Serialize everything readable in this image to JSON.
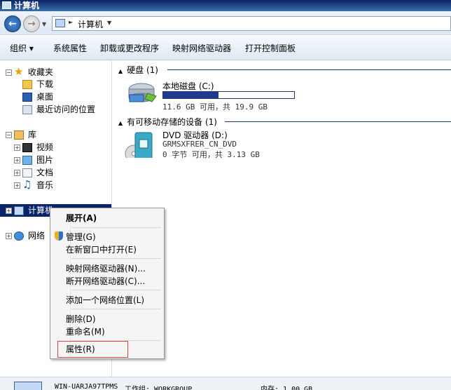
{
  "window": {
    "title": "计算机"
  },
  "address": {
    "path": "计算机"
  },
  "toolbar": {
    "items": [
      "组织",
      "系统属性",
      "卸载或更改程序",
      "映射网络驱动器",
      "打开控制面板"
    ],
    "organize_arrow": "▾"
  },
  "nav": {
    "favorites": "收藏夹",
    "downloads": "下载",
    "desktop": "桌面",
    "recent": "最近访问的位置",
    "libraries": "库",
    "videos": "视频",
    "pictures": "图片",
    "documents": "文档",
    "music": "音乐",
    "computer": "计算机",
    "network": "网络"
  },
  "content": {
    "hard_disks_header": "硬盘 (1)",
    "local_disk": {
      "name": "本地磁盘 (C:)",
      "space": "11.6 GB 可用，共 19.9 GB",
      "used_fraction": 0.42
    },
    "removable_header": "有可移动存储的设备 (1)",
    "dvd": {
      "name": "DVD 驱动器 (D:)",
      "label": "GRMSXFRER_CN_DVD",
      "space": "0 字节 可用，共 3.13 GB"
    }
  },
  "context_menu": {
    "expand": "展开(A)",
    "manage": "管理(G)",
    "open_new_window": "在新窗口中打开(E)",
    "map_drive": "映射网络驱动器(N)...",
    "disconnect_drive": "断开网络驱动器(C)...",
    "add_location": "添加一个网络位置(L)",
    "delete": "删除(D)",
    "rename": "重命名(M)",
    "properties": "属性(R)"
  },
  "status": {
    "computer_name": "WIN-UARJA97TPMS",
    "workgroup": "工作组: WORKGROUP",
    "memory": "内存: 1.00 GB"
  }
}
